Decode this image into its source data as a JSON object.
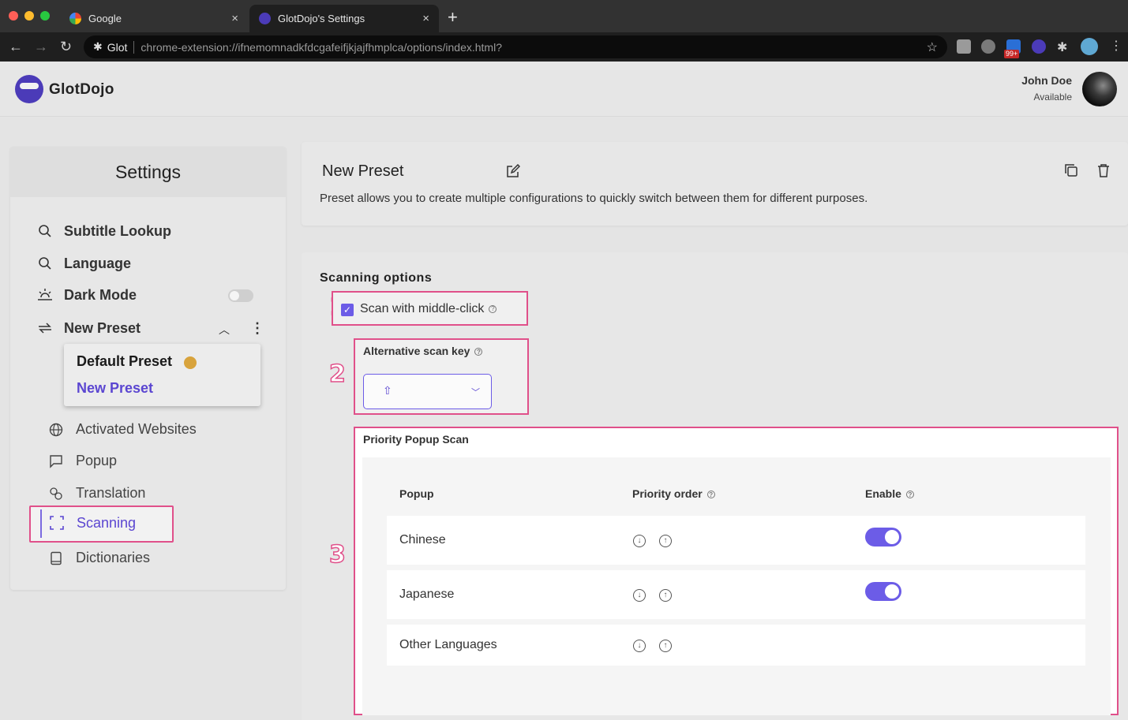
{
  "browser": {
    "tabs": [
      {
        "label": "Google",
        "active": false
      },
      {
        "label": "GlotDojo's Settings",
        "active": true
      }
    ],
    "close_glyph": "×",
    "new_tab_glyph": "+",
    "address": {
      "site_label": "Glot",
      "url": "chrome-extension://ifnemomnadkfdcgafeifjkjajfhmplca/options/index.html?"
    },
    "extension_badge": "99+"
  },
  "header": {
    "brand": "GlotDojo",
    "user_name": "John Doe",
    "user_status": "Available"
  },
  "sidebar": {
    "title": "Settings",
    "items": [
      {
        "label": "Subtitle Lookup",
        "icon": "search-icon"
      },
      {
        "label": "Language",
        "icon": "search-icon"
      },
      {
        "label": "Dark Mode",
        "icon": "sunset-icon"
      },
      {
        "label": "New Preset",
        "icon": "swap-icon"
      }
    ],
    "preset_menu": {
      "default_label": "Default Preset",
      "new_label": "New Preset"
    },
    "sub_items": [
      {
        "label": "Activated Websites",
        "icon": "globe-icon"
      },
      {
        "label": "Popup",
        "icon": "chat-icon"
      },
      {
        "label": "Translation",
        "icon": "translate-icon"
      },
      {
        "label": "Scanning",
        "icon": "scan-icon",
        "active": true
      },
      {
        "label": "Dictionaries",
        "icon": "book-icon"
      }
    ]
  },
  "preset": {
    "title": "New Preset",
    "description": "Preset allows you to create multiple configurations to quickly switch between them for different purposes."
  },
  "scanning": {
    "title": "Scanning options",
    "annotations": [
      "1",
      "2",
      "3"
    ],
    "middle_click": {
      "label": "Scan with middle-click",
      "checked": true
    },
    "alt_key": {
      "label": "Alternative scan key",
      "value": "⇧"
    },
    "priority": {
      "label": "Priority Popup Scan",
      "columns": [
        "Popup",
        "Priority order",
        "Enable"
      ],
      "rows": [
        {
          "name": "Chinese",
          "enabled": true
        },
        {
          "name": "Japanese",
          "enabled": true
        },
        {
          "name": "Other Languages",
          "enabled": null
        }
      ]
    }
  },
  "colors": {
    "accent": "#6c5ce7",
    "highlight": "#e0508a"
  }
}
